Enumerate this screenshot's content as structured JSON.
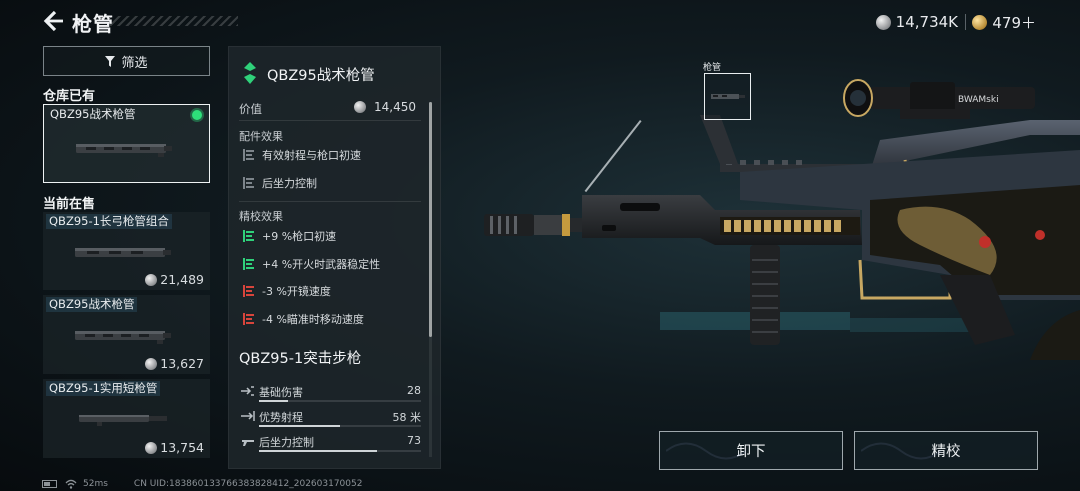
{
  "header": {
    "title": "枪管",
    "currency_silver": "14,734K",
    "currency_gold": "479＋"
  },
  "filter": {
    "label": "筛选"
  },
  "sections": {
    "owned": "仓库已有",
    "on_sale": "当前在售"
  },
  "owned_items": [
    {
      "name": "QBZ95战术枪管",
      "equipped": true
    }
  ],
  "sale_items": [
    {
      "name": "QBZ95-1长弓枪管组合",
      "price": "21,489"
    },
    {
      "name": "QBZ95战术枪管",
      "price": "13,627"
    },
    {
      "name": "QBZ95-1实用短枪管",
      "price": "13,754"
    }
  ],
  "detail": {
    "attachment_name": "QBZ95战术枪管",
    "value_label": "价值",
    "value": "14,450",
    "accessory_effects_title": "配件效果",
    "accessory_effects": [
      "有效射程与枪口初速",
      "后坐力控制"
    ],
    "refine_effects_title": "精校效果",
    "refine_effects": [
      {
        "text": "+9 %枪口初速",
        "positive": true
      },
      {
        "text": "+4 %开火时武器稳定性",
        "positive": true
      },
      {
        "text": "-3 %开镜速度",
        "positive": false
      },
      {
        "text": "-4 %瞄准时移动速度",
        "positive": false
      }
    ],
    "weapon_name": "QBZ95-1突击步枪",
    "stats": [
      {
        "label": "基础伤害",
        "value": "28",
        "fraction": 0.18
      },
      {
        "label": "优势射程",
        "value": "58 米",
        "fraction": 0.5
      },
      {
        "label": "后坐力控制",
        "value": "73",
        "fraction": 0.73
      }
    ]
  },
  "slot": {
    "label": "枪管"
  },
  "scope_text": "BWAMski",
  "buttons": {
    "unequip": "卸下",
    "refine": "精校"
  },
  "footer": {
    "ping": "52ms",
    "uid": "CN UID:18386013376638382841​2_202603170052"
  },
  "colors": {
    "positive": "#2fd17a",
    "negative": "#d8453c",
    "equipped": "#2ee07a",
    "attachment_icon": "#2fd17a"
  }
}
